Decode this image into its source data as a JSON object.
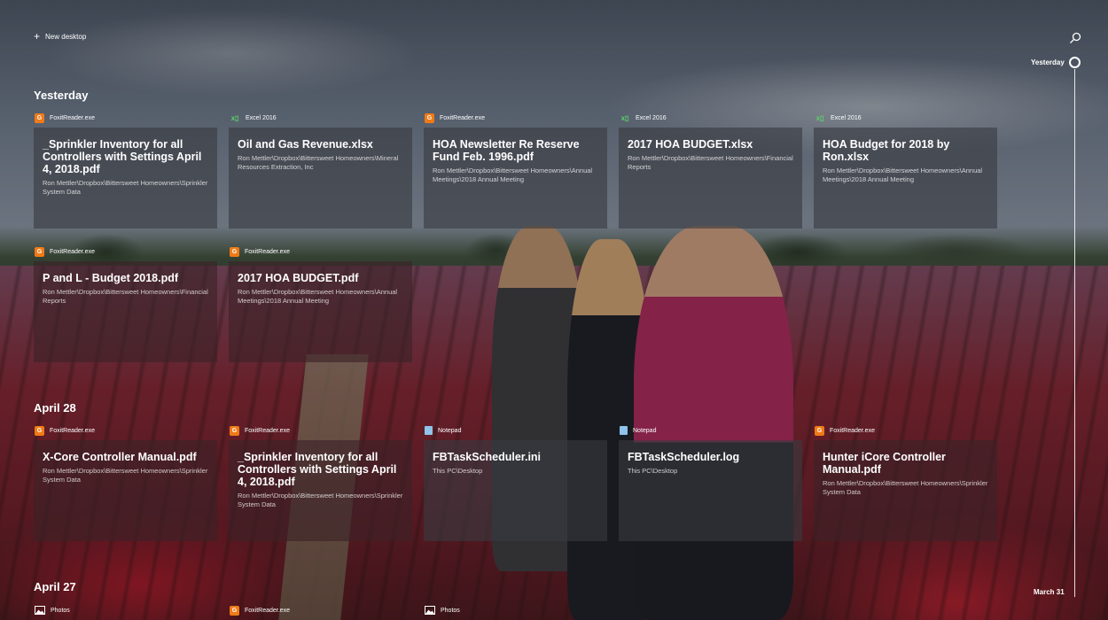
{
  "new_desktop": {
    "label": "New desktop",
    "icon": "plus-icon"
  },
  "search": {
    "icon": "search-icon"
  },
  "timeline": {
    "top_label": "Yesterday",
    "bottom_label": "March 31"
  },
  "sections": [
    {
      "heading": "Yesterday",
      "items": [
        {
          "app": "FoxitReader.exe",
          "app_icon": "foxit-icon",
          "title": "_Sprinkler Inventory for all Controllers with Settings April 4, 2018.pdf",
          "path": "Ron Mettler\\Dropbox\\Bittersweet Homeowners\\Sprinkler System Data"
        },
        {
          "app": "Excel 2016",
          "app_icon": "excel-icon",
          "title": "Oil and Gas Revenue.xlsx",
          "path": "Ron Mettler\\Dropbox\\Bittersweet Homeowners\\Mineral Resources Extraction, Inc"
        },
        {
          "app": "FoxitReader.exe",
          "app_icon": "foxit-icon",
          "title": "HOA Newsletter Re Reserve Fund Feb. 1996.pdf",
          "path": "Ron Mettler\\Dropbox\\Bittersweet Homeowners\\Annual Meetings\\2018 Annual Meeting"
        },
        {
          "app": "Excel 2016",
          "app_icon": "excel-icon",
          "title": "2017 HOA BUDGET.xlsx",
          "path": "Ron Mettler\\Dropbox\\Bittersweet Homeowners\\Financial Reports"
        },
        {
          "app": "Excel 2016",
          "app_icon": "excel-icon",
          "title": "HOA Budget for 2018 by Ron.xlsx",
          "path": "Ron Mettler\\Dropbox\\Bittersweet Homeowners\\Annual Meetings\\2018 Annual Meeting"
        },
        {
          "app": "FoxitReader.exe",
          "app_icon": "foxit-icon",
          "title": "P and L - Budget 2018.pdf",
          "path": "Ron Mettler\\Dropbox\\Bittersweet Homeowners\\Financial Reports"
        },
        {
          "app": "FoxitReader.exe",
          "app_icon": "foxit-icon",
          "title": "2017 HOA BUDGET.pdf",
          "path": "Ron Mettler\\Dropbox\\Bittersweet Homeowners\\Annual Meetings\\2018 Annual Meeting"
        }
      ]
    },
    {
      "heading": "April 28",
      "items": [
        {
          "app": "FoxitReader.exe",
          "app_icon": "foxit-icon",
          "title": "X-Core Controller Manual.pdf",
          "path": "Ron Mettler\\Dropbox\\Bittersweet Homeowners\\Sprinkler System Data"
        },
        {
          "app": "FoxitReader.exe",
          "app_icon": "foxit-icon",
          "title": "_Sprinkler Inventory for all Controllers with Settings April 4, 2018.pdf",
          "path": "Ron Mettler\\Dropbox\\Bittersweet Homeowners\\Sprinkler System Data"
        },
        {
          "app": "Notepad",
          "app_icon": "notepad-icon",
          "title": "FBTaskScheduler.ini",
          "path": "This PC\\Desktop"
        },
        {
          "app": "Notepad",
          "app_icon": "notepad-icon",
          "title": "FBTaskScheduler.log",
          "path": "This PC\\Desktop"
        },
        {
          "app": "FoxitReader.exe",
          "app_icon": "foxit-icon",
          "title": "Hunter iCore Controller Manual.pdf",
          "path": "Ron Mettler\\Dropbox\\Bittersweet Homeowners\\Sprinkler System Data"
        }
      ]
    },
    {
      "heading": "April 27",
      "items": [
        {
          "app": "Photos",
          "app_icon": "photos-icon"
        },
        {
          "app": "FoxitReader.exe",
          "app_icon": "foxit-icon"
        },
        {
          "app": "Photos",
          "app_icon": "photos-icon"
        }
      ]
    }
  ]
}
